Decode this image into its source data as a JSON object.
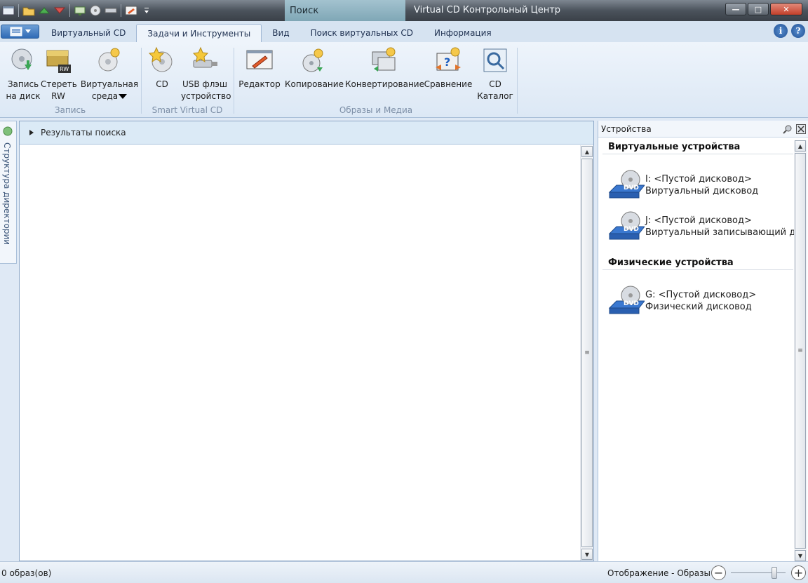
{
  "titlebar": {
    "context_tab": "Поиск",
    "title": "Virtual CD Контрольный Центр",
    "minimize": "—",
    "maximize": "□",
    "close": "✕"
  },
  "tabs": [
    {
      "label": "Виртуальный CD",
      "active": false
    },
    {
      "label": "Задачи и Инструменты",
      "active": true
    },
    {
      "label": "Вид",
      "active": false
    },
    {
      "label": "Поиск виртуальных CD",
      "active": false
    },
    {
      "label": "Информация",
      "active": false
    }
  ],
  "help": {
    "info": "i",
    "help": "?"
  },
  "ribbon": {
    "groups": {
      "zapis": "Запись",
      "smart": "Smart Virtual CD",
      "obrazy": "Образы и Медиа"
    },
    "buttons": {
      "burn_1": "Запись",
      "burn_2": "на диск",
      "erase_1": "Стереть",
      "erase_2": "RW",
      "venv_1": "Виртуальная",
      "venv_2": "среда",
      "cd": "CD",
      "usb_1": "USB флэш",
      "usb_2": "устройство",
      "editor": "Редактор",
      "copy": "Копирование",
      "convert": "Конвертирование",
      "compare": "Сравнение",
      "catalog_1": "CD",
      "catalog_2": "Каталог"
    }
  },
  "left_pane": {
    "label": "Структура директории"
  },
  "main": {
    "header": "Результаты поиска"
  },
  "devices": {
    "title": "Устройства",
    "virtual_section": "Виртуальные устройства",
    "physical_section": "Физические устройства",
    "virtual": [
      {
        "line1": "I: <Пустой дисковод>",
        "line2": "Виртуальный дисковод"
      },
      {
        "line1": "J: <Пустой дисковод>",
        "line2": "Виртуальный записывающий ди"
      }
    ],
    "physical": [
      {
        "line1": "G: <Пустой дисковод>",
        "line2": "Физический дисковод"
      }
    ]
  },
  "status": {
    "left": "0 образ(ов)",
    "right": "Отображение - Образы",
    "zoom": 0.8
  }
}
